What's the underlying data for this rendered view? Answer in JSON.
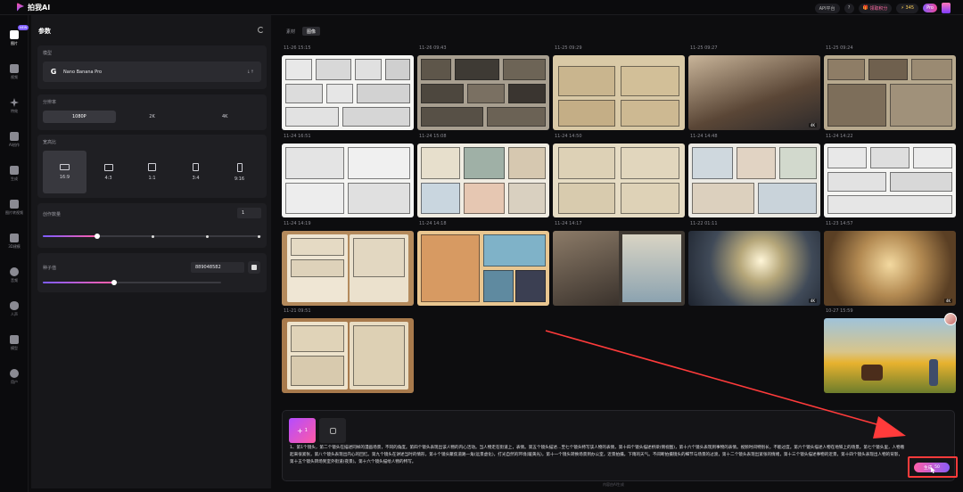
{
  "app": {
    "name": "拍我AI"
  },
  "topbar": {
    "api_label": "API平台",
    "gift_label": "领取积分",
    "points": "345",
    "pro_label": "Pro"
  },
  "rail": {
    "items": [
      {
        "label": "图片",
        "icon": "image-icon",
        "active": true,
        "badge": "NEW"
      },
      {
        "label": "视频",
        "icon": "video-icon"
      },
      {
        "label": "特效",
        "icon": "sparkle-icon"
      },
      {
        "label": "AI创作",
        "icon": "brush-icon"
      },
      {
        "label": "生成",
        "icon": "play-icon"
      },
      {
        "label": "图片转视频",
        "icon": "convert-icon"
      },
      {
        "label": "3D建模",
        "icon": "cube-icon"
      },
      {
        "label": "音频",
        "icon": "audio-icon"
      },
      {
        "label": "人声",
        "icon": "lips-icon"
      },
      {
        "label": "模型",
        "icon": "tool-icon"
      },
      {
        "label": "用户",
        "icon": "face-icon"
      }
    ]
  },
  "params": {
    "title": "参数",
    "model": {
      "title": "模型",
      "name": "Nano Banana Pro",
      "tag": "↓↑"
    },
    "resolution": {
      "title": "分辨率",
      "options": [
        "1080P",
        "2K",
        "4K"
      ],
      "selected": "1080P"
    },
    "aspect": {
      "title": "宽高比",
      "options": [
        "16:9",
        "4:3",
        "1:1",
        "3:4",
        "9:16"
      ],
      "selected": "16:9"
    },
    "count": {
      "title": "创作数量",
      "value": "1",
      "level": 0.25
    },
    "seed": {
      "title": "种子值",
      "value": "889048582",
      "level": 0.4
    }
  },
  "main": {
    "tabs": [
      "素材",
      "图像"
    ],
    "active_tab": "图像",
    "rows": [
      {
        "timestamps": [
          "11-26 15:15",
          "11-26 09:43",
          "11-25 09:29",
          "11-25 09:27",
          "11-25 09:24"
        ]
      },
      {
        "timestamps": [
          "11-24 16:51",
          "11-24 15:08",
          "11-24 14:50",
          "11-24 14:48",
          "11-24 14:22"
        ]
      },
      {
        "timestamps": [
          "11-24 14:19",
          "11-24 14:18",
          "11-24 14:17",
          "11-22 01:11",
          "11-23 14:57"
        ]
      },
      {
        "timestamps": [
          "11-21 09:51",
          "",
          "",
          "",
          "10-27 15:59"
        ]
      }
    ],
    "thumb_badge": "4K"
  },
  "prompt": {
    "text": "1、第1个镜头，第二个镜头在描述同样的漫画场景，不同的角度。第四个镜头表现出该人物的内心活动。当人物走在街道上，表情。第五个镜头描述…至七个镜头特写该人物的表情，第十四个镜头描述桥梁(侧视图)，第十六个镜头表现到事物的表情。视频时间特别长，不能过度。第六个镜头描述人物在地铁上的场景。第七个镜头里，人物看起来很紧张，第八个镜头表现出内心的回忆。第九个镜头在讲述当时的情形，第十个镜头聚焦道路一角(远景虚化)，打光自然的环境(暖黄光)，第十一个镜头转换场景到办公室，近景拍摄。下雨的天气。不间断拍摄镜头的细节与场景的过渡，第十二个镜头表现出紧张的情绪，第十三个镜头描述事物的近景，第十四个镜头表现出人物的背影，第十五个镜头转场到室外街道(夜景)。第十六个镜头描绘人物的特写。",
    "count_label": "1",
    "generate_label": "生成",
    "generate_cost": "50",
    "footer": "内容由AI生成"
  },
  "colors": {
    "accent_pink": "#ff5fa8",
    "accent_purple": "#8b5cf6",
    "annotation_red": "#ff3b3b"
  }
}
